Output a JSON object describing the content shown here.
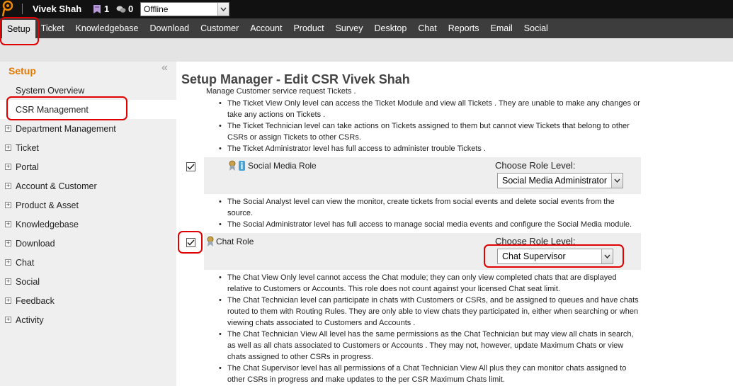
{
  "topbar": {
    "username": "Vivek Shah",
    "stat1_icon": "ticket-icon",
    "stat1_value": "1",
    "stat2_icon": "chat-bubbles-icon",
    "stat2_value": "0",
    "status_value": "Offline"
  },
  "nav": {
    "items": [
      "Setup",
      "Ticket",
      "Knowledgebase",
      "Download",
      "Customer",
      "Account",
      "Product",
      "Survey",
      "Desktop",
      "Chat",
      "Reports",
      "Email",
      "Social"
    ]
  },
  "sidebar": {
    "title": "Setup",
    "collapse_icon": "«",
    "items": [
      {
        "label": "System Overview"
      },
      {
        "label": "CSR Management"
      },
      {
        "label": "Department Management"
      },
      {
        "label": "Ticket"
      },
      {
        "label": "Portal"
      },
      {
        "label": "Account & Customer"
      },
      {
        "label": "Product & Asset"
      },
      {
        "label": "Knowledgebase"
      },
      {
        "label": "Download"
      },
      {
        "label": "Chat"
      },
      {
        "label": "Social"
      },
      {
        "label": "Feedback"
      },
      {
        "label": "Activity"
      }
    ],
    "expand_glyph": "+"
  },
  "main": {
    "title": "Setup Manager - Edit CSR Vivek Shah",
    "intro": "Manage Customer service request Tickets .",
    "ticket_bullets": [
      "The Ticket View Only level can access the Ticket Module and view all Tickets . They are unable to make any changes or take any actions on Tickets .",
      "The Ticket Technician level can take actions on Tickets assigned to them but cannot view Tickets that belong to other CSRs or assign Tickets to other CSRs.",
      "The Ticket Administrator level has full access to administer trouble Tickets ."
    ],
    "social_role": {
      "checked": true,
      "name": "Social Media Role",
      "choose_label": "Choose Role Level:",
      "selected": "Social Media Administrator",
      "icons": [
        "ribbon-badge-icon",
        "info-badge-icon"
      ]
    },
    "social_bullets": [
      "The Social Analyst level can view the monitor, create tickets from social events and delete social events from the source.",
      "The Social Administrator level has full access to manage social media events and configure the Social Media module."
    ],
    "chat_role": {
      "checked": true,
      "name": "Chat Role",
      "choose_label": "Choose Role Level:",
      "selected": "Chat Supervisor",
      "icons": [
        "ribbon-badge-icon"
      ]
    },
    "chat_bullets": [
      "The Chat View Only level cannot access the Chat module; they can only view completed chats that are displayed relative to Customers or Accounts. This role does not count against your licensed Chat seat limit.",
      "The Chat Technician level can participate in chats with Customers or CSRs, and be assigned to queues and have chats routed to them with Routing Rules. They are only able to view chats they participated in, either when searching or when viewing chats associated to Customers and Accounts .",
      "The Chat Technician View All level has the same permissions as the Chat Technician but may view all chats in search, as well as all chats associated to Customers or Accounts . They may not, however, update Maximum Chats or view chats assigned to other CSRs in progress.",
      "The Chat Supervisor level has all permissions of a Chat Technician View All plus they can monitor chats assigned to other CSRs in progress and make updates to the per CSR Maximum Chats limit."
    ]
  },
  "colors": {
    "topbar": "#111111",
    "navbar": "#3d3d3d",
    "sidebar_title": "#e67a00",
    "annotation": "#e00000"
  }
}
